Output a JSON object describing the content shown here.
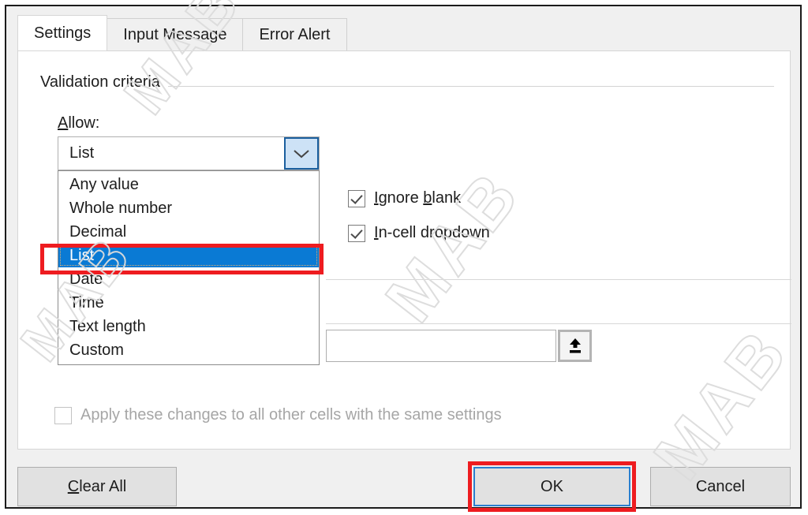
{
  "dialog": {
    "tabs": [
      {
        "label": "Settings",
        "active": true
      },
      {
        "label": "Input Message",
        "active": false
      },
      {
        "label": "Error Alert",
        "active": false
      }
    ],
    "group_label": "Validation criteria",
    "allow": {
      "label_prefix": "A",
      "label_rest": "llow:",
      "value": "List",
      "arrow_icon": "chevron-down-icon",
      "options": [
        "Any value",
        "Whole number",
        "Decimal",
        "List",
        "Date",
        "Time",
        "Text length",
        "Custom"
      ],
      "selected_option": "List"
    },
    "checkboxes": {
      "ignore_blank": {
        "label_a": "I",
        "label_b": "gnore ",
        "label_c": "b",
        "label_d": "lank",
        "checked": true
      },
      "in_cell_dropdown": {
        "label_a": "I",
        "label_b": "n-cell dropdown",
        "checked": true
      },
      "apply_all": {
        "label": "Apply these changes to all other cells with the same settings",
        "checked": false,
        "disabled": true
      }
    },
    "source": {
      "value": "",
      "collapse_icon": "range-collapse-icon"
    },
    "buttons": {
      "clear_all_prefix": "C",
      "clear_all_rest": "lear All",
      "ok": "OK",
      "cancel": "Cancel"
    },
    "annotations": {
      "highlight_color": "#ee1c20",
      "selection_color": "#0a7ad4",
      "default_button_border": "#2a7fcf"
    },
    "watermark": {
      "text": "MAB"
    }
  }
}
